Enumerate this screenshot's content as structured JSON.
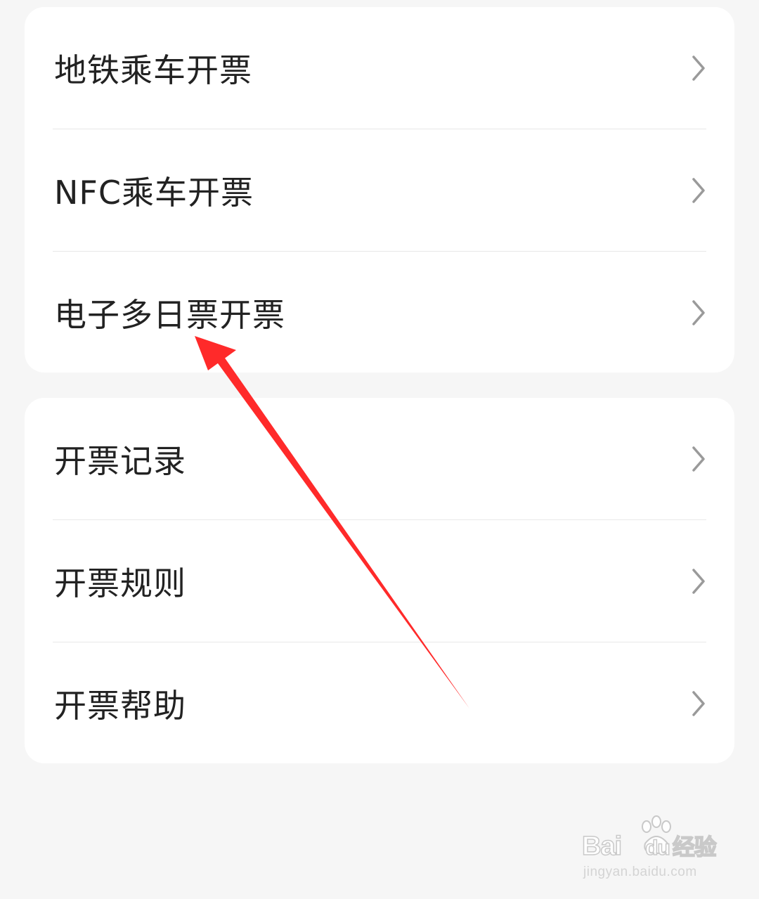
{
  "menu_group_1": {
    "items": [
      {
        "label": "地铁乘车开票"
      },
      {
        "label": "NFC乘车开票"
      },
      {
        "label": "电子多日票开票"
      }
    ]
  },
  "menu_group_2": {
    "items": [
      {
        "label": "开票记录"
      },
      {
        "label": "开票规则"
      },
      {
        "label": "开票帮助"
      }
    ]
  },
  "icons": {
    "row_chevron": "chevron-right-icon"
  },
  "annotation": {
    "color": "#ff2a2a"
  },
  "watermark": {
    "brand_latin": "Bai",
    "brand_du": "du",
    "brand_cn": "经验",
    "url": "jingyan.baidu.com"
  },
  "colors": {
    "background": "#f6f6f6",
    "card": "#ffffff",
    "text": "#222222",
    "divider": "#e8e8e8",
    "chevron": "#9a9a9a"
  }
}
